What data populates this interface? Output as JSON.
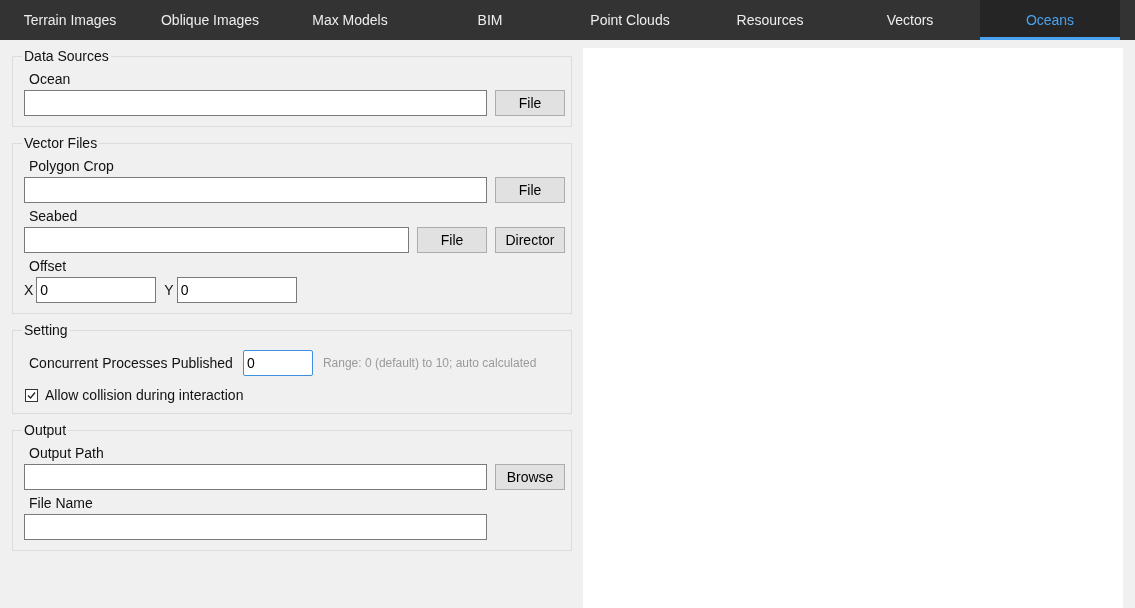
{
  "tabs": [
    {
      "label": "Terrain Images",
      "selected": false
    },
    {
      "label": "Oblique Images",
      "selected": false
    },
    {
      "label": "Max Models",
      "selected": false
    },
    {
      "label": "BIM",
      "selected": false
    },
    {
      "label": "Point Clouds",
      "selected": false
    },
    {
      "label": "Resources",
      "selected": false
    },
    {
      "label": "Vectors",
      "selected": false
    },
    {
      "label": "Oceans",
      "selected": true
    }
  ],
  "groups": [
    {
      "title": "Data Sources",
      "rows": [
        {
          "kind": "label",
          "text": "Ocean"
        },
        {
          "kind": "path",
          "buttons": [
            "File"
          ]
        }
      ]
    },
    {
      "title": "Vector Files",
      "rows": [
        {
          "kind": "label",
          "text": "Polygon Crop"
        },
        {
          "kind": "path",
          "buttons": [
            "File"
          ]
        },
        {
          "kind": "label",
          "text": "Seabed"
        },
        {
          "kind": "path",
          "buttons": [
            "File",
            "Director"
          ]
        },
        {
          "kind": "label",
          "text": "Offset"
        },
        {
          "kind": "offset",
          "fields": [
            {
              "label": "X",
              "value": "0"
            },
            {
              "label": "Y",
              "value": "0"
            }
          ]
        }
      ]
    },
    {
      "title": "Setting",
      "rows": [
        {
          "kind": "number",
          "label": "Concurrent Processes Published",
          "value": "0",
          "focused": true,
          "hint": "Range: 0 (default) to 10; auto calculated"
        },
        {
          "kind": "checkbox",
          "label": "Allow collision during interaction",
          "checked": true
        }
      ]
    },
    {
      "title": "Output",
      "rows": [
        {
          "kind": "label",
          "text": "Output Path"
        },
        {
          "kind": "path",
          "buttons": [
            "Browse"
          ]
        },
        {
          "kind": "label",
          "text": "File Name"
        },
        {
          "kind": "path",
          "buttons": []
        }
      ]
    }
  ]
}
